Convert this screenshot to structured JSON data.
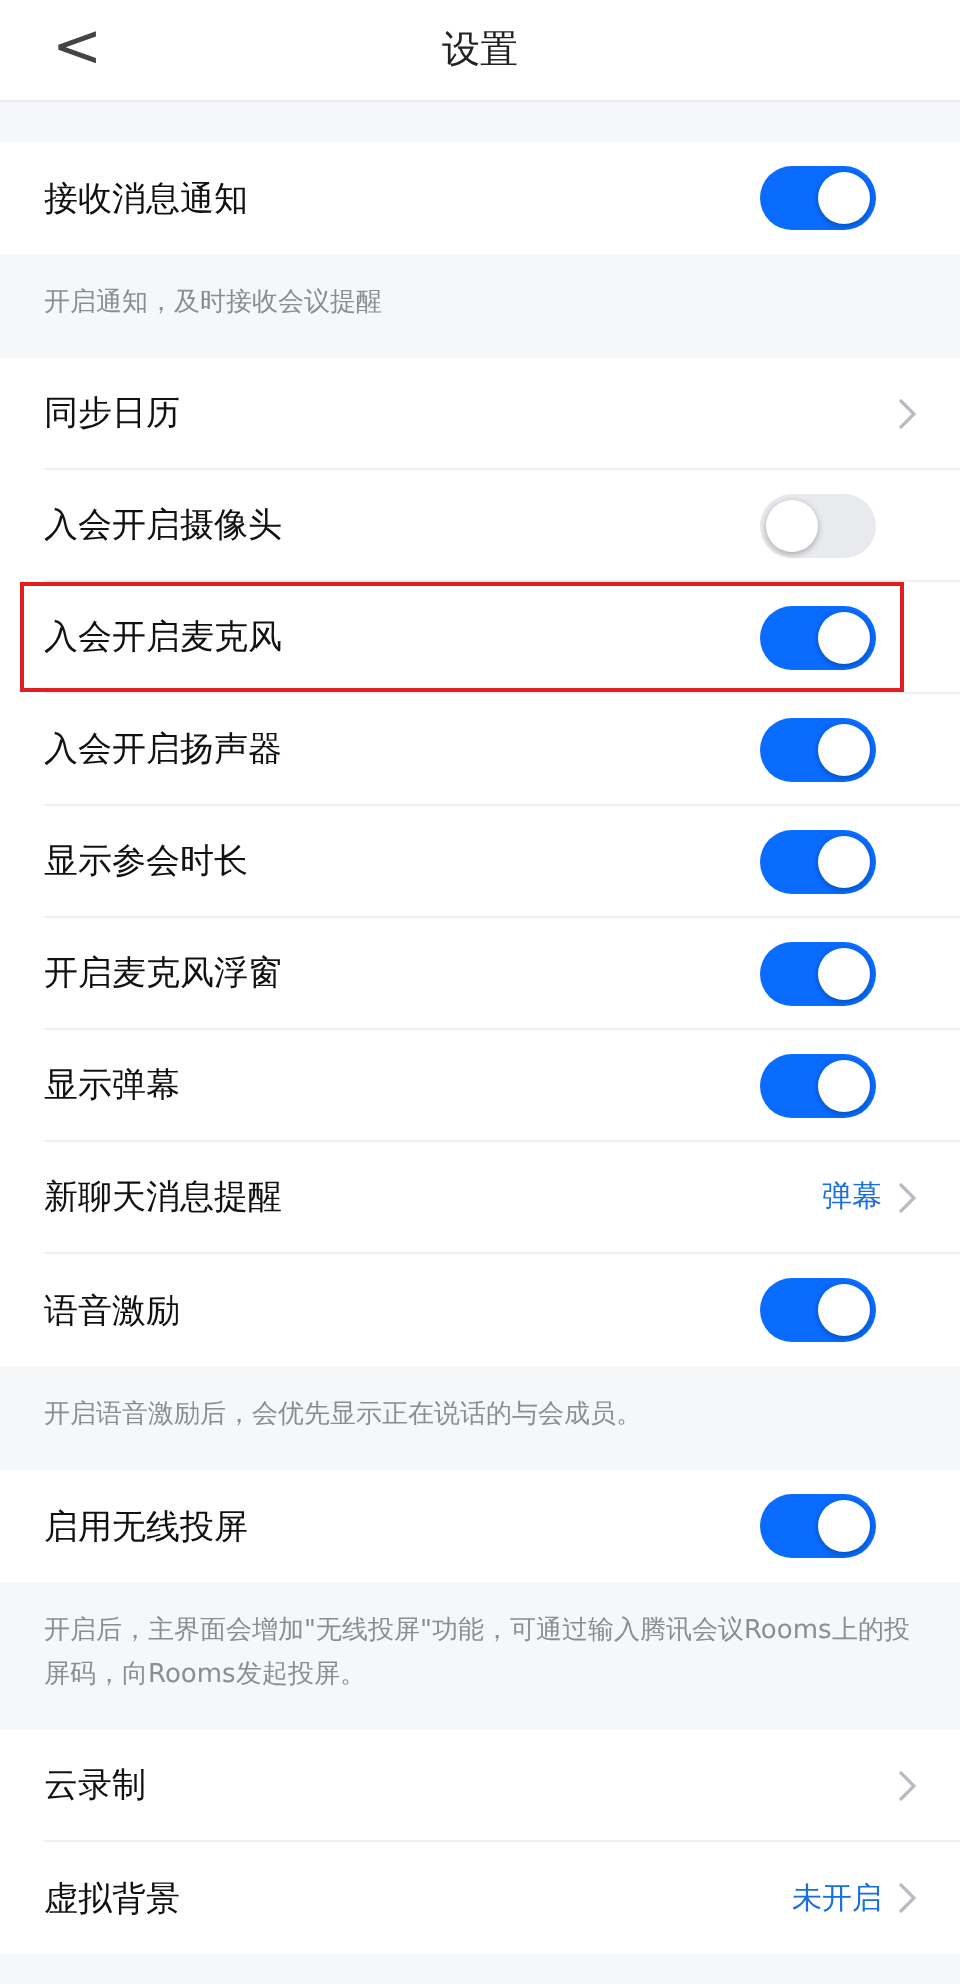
{
  "header": {
    "back": "<",
    "title": "设置"
  },
  "sections": [
    {
      "rows": [
        {
          "label": "接收消息通知",
          "kind": "toggle",
          "on": true,
          "highlighted": false
        }
      ],
      "note": "开启通知，及时接收会议提醒"
    },
    {
      "rows": [
        {
          "label": "同步日历",
          "kind": "link",
          "highlighted": false
        },
        {
          "label": "入会开启摄像头",
          "kind": "toggle",
          "on": false,
          "highlighted": false
        },
        {
          "label": "入会开启麦克风",
          "kind": "toggle",
          "on": true,
          "highlighted": true
        },
        {
          "label": "入会开启扬声器",
          "kind": "toggle",
          "on": true,
          "highlighted": false
        },
        {
          "label": "显示参会时长",
          "kind": "toggle",
          "on": true,
          "highlighted": false
        },
        {
          "label": "开启麦克风浮窗",
          "kind": "toggle",
          "on": true,
          "highlighted": false
        },
        {
          "label": "显示弹幕",
          "kind": "toggle",
          "on": true,
          "highlighted": false
        },
        {
          "label": "新聊天消息提醒",
          "kind": "link",
          "value": "弹幕",
          "highlighted": false
        },
        {
          "label": "语音激励",
          "kind": "toggle",
          "on": true,
          "highlighted": false
        }
      ],
      "note": "开启语音激励后，会优先显示正在说话的与会成员。"
    },
    {
      "rows": [
        {
          "label": "启用无线投屏",
          "kind": "toggle",
          "on": true,
          "highlighted": false
        }
      ],
      "note": "开启后，主界面会增加\"无线投屏\"功能，可通过输入腾讯会议Rooms上的投屏码，向Rooms发起投屏。"
    },
    {
      "rows": [
        {
          "label": "云录制",
          "kind": "link",
          "highlighted": false
        },
        {
          "label": "虚拟背景",
          "kind": "link",
          "value": "未开启",
          "highlighted": false
        }
      ]
    }
  ]
}
